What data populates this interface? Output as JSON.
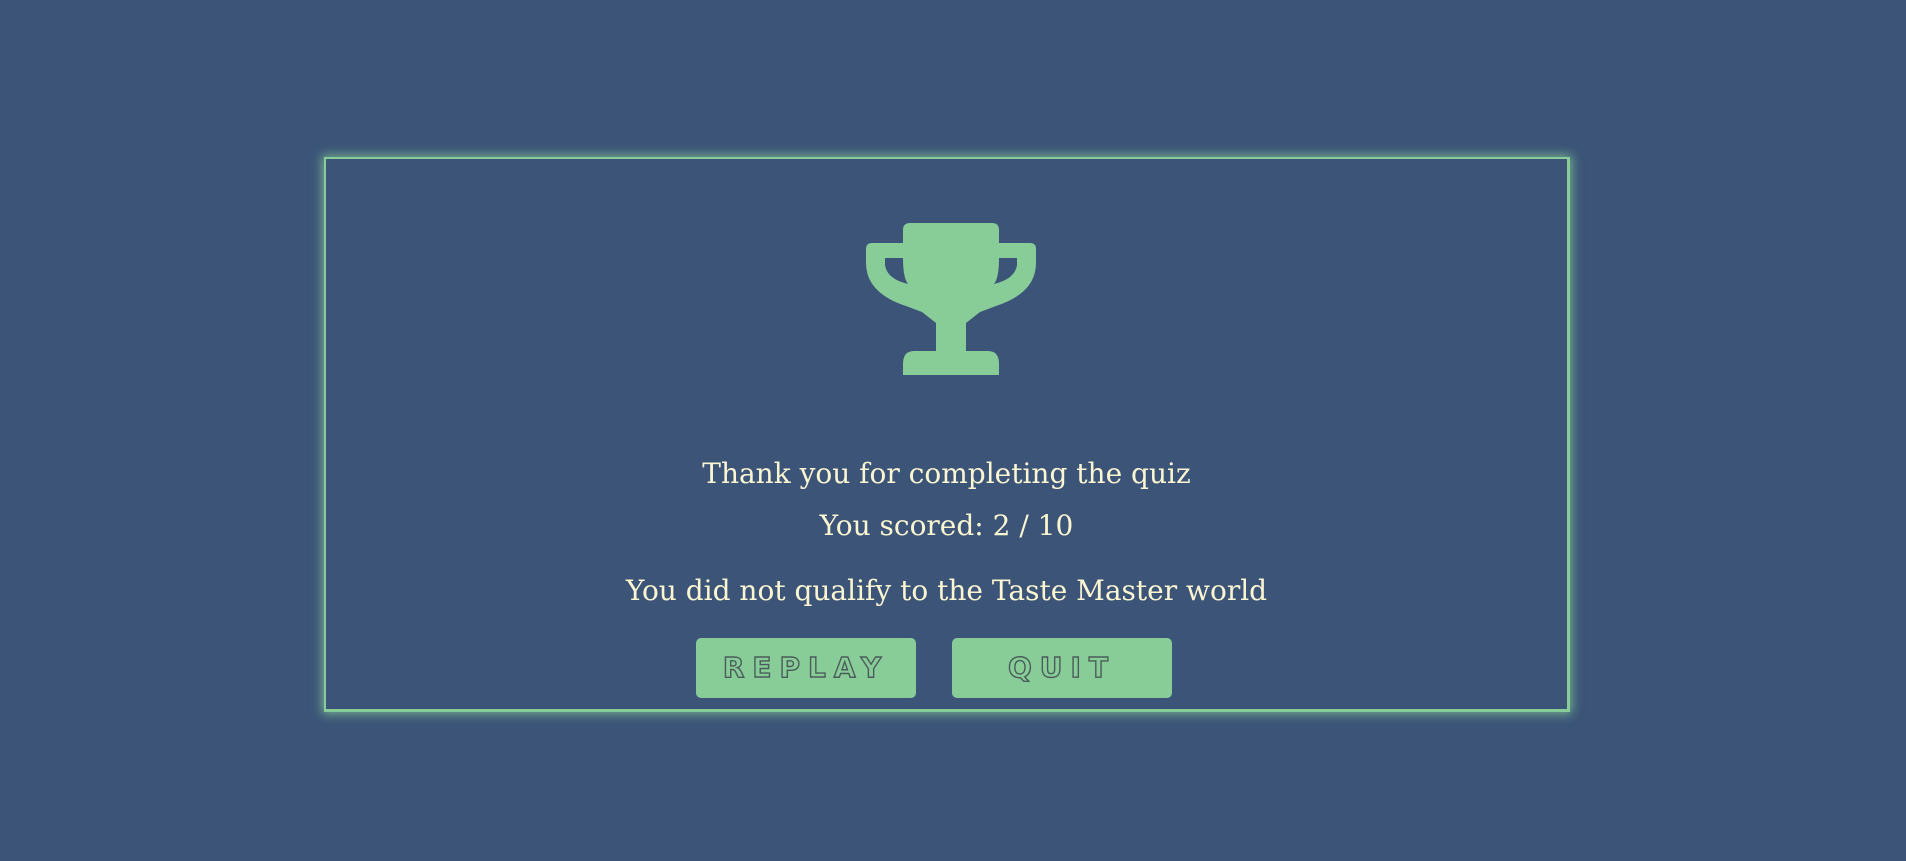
{
  "colors": {
    "background": "#3b5478",
    "accent": "#88cc98",
    "text": "#fbf6d2"
  },
  "result": {
    "icon": "trophy-icon",
    "thank_you": "Thank you for completing the quiz",
    "score_text": "You scored: 2 / 10",
    "qualify_text": "You did not qualify to the Taste Master world"
  },
  "actions": {
    "replay_label": "REPLAY",
    "quit_label": "QUIT"
  }
}
